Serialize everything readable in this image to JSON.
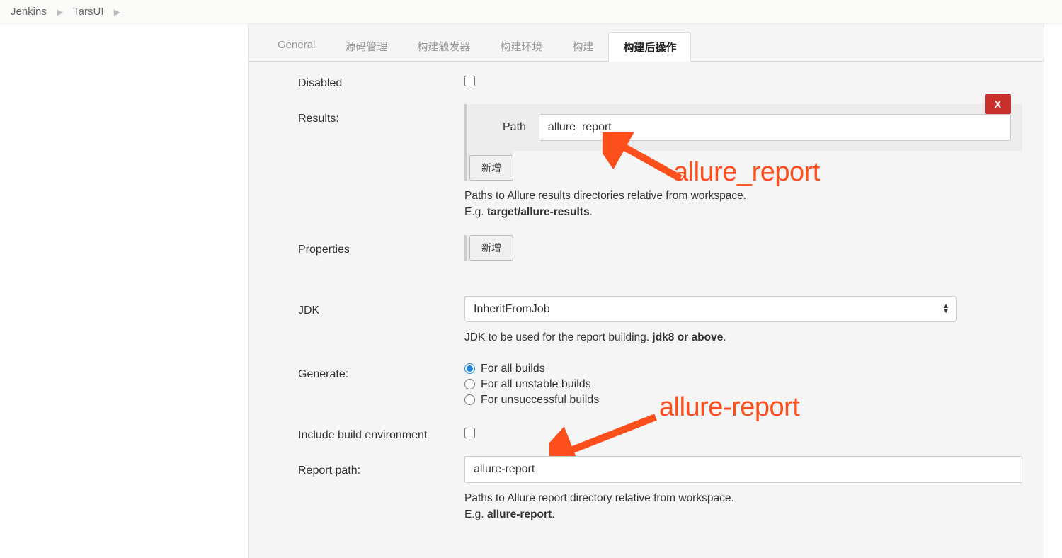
{
  "breadcrumb": {
    "root": "Jenkins",
    "job": "TarsUI"
  },
  "tabs": [
    "General",
    "源码管理",
    "构建触发器",
    "构建环境",
    "构建",
    "构建后操作"
  ],
  "active_tab": "构建后操作",
  "fields": {
    "disabled": {
      "label": "Disabled",
      "checked": false
    },
    "results": {
      "label": "Results:",
      "path_label": "Path",
      "path_value": "allure_report",
      "remove_btn": "X",
      "add_btn": "新增",
      "help1": "Paths to Allure results directories relative from workspace.",
      "help2_prefix": "E.g. ",
      "help2_bold": "target/allure-results"
    },
    "properties": {
      "label": "Properties",
      "add_btn": "新增"
    },
    "jdk": {
      "label": "JDK",
      "value": "InheritFromJob",
      "help_prefix": "JDK to be used for the report building. ",
      "help_bold": "jdk8 or above"
    },
    "generate": {
      "label": "Generate:",
      "options": [
        "For all builds",
        "For all unstable builds",
        "For unsuccessful builds"
      ],
      "selected": 0
    },
    "include_env": {
      "label": "Include build environment",
      "checked": false
    },
    "report_path": {
      "label": "Report path:",
      "value": "allure-report",
      "help1": "Paths to Allure report directory relative from workspace.",
      "help2_prefix": "E.g. ",
      "help2_bold": "allure-report"
    }
  },
  "annotations": {
    "top": "allure_report",
    "bottom": "allure-report"
  }
}
